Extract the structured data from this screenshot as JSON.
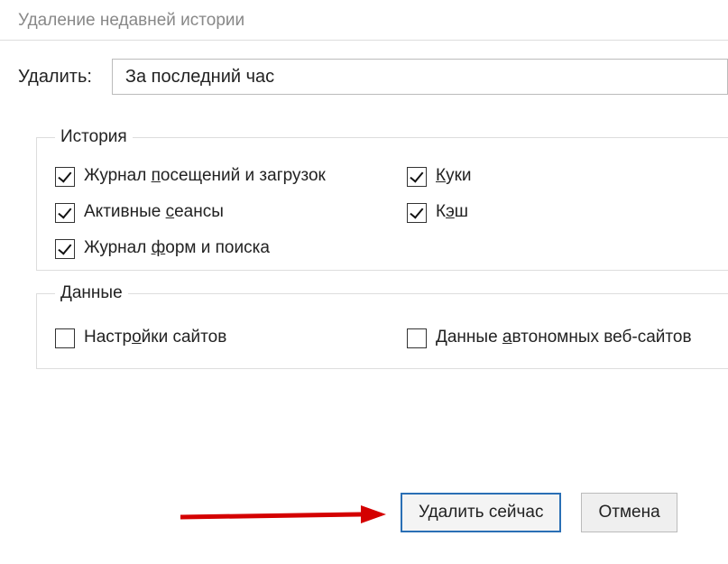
{
  "dialog": {
    "title": "Удаление недавней истории",
    "range_label": "Удалить:",
    "range_value": "За последний час"
  },
  "groups": {
    "history": {
      "legend": "История",
      "items": [
        {
          "label_pre": "Журнал ",
          "label_u": "п",
          "label_post": "осещений и загрузок",
          "checked": true
        },
        {
          "label_pre": "",
          "label_u": "К",
          "label_post": "уки",
          "checked": true
        },
        {
          "label_pre": "Активные ",
          "label_u": "с",
          "label_post": "еансы",
          "checked": true
        },
        {
          "label_pre": "К",
          "label_u": "э",
          "label_post": "ш",
          "checked": true
        },
        {
          "label_pre": "Журнал ",
          "label_u": "ф",
          "label_post": "орм и поиска",
          "checked": true
        }
      ]
    },
    "data": {
      "legend": "Данные",
      "items": [
        {
          "label_pre": "Настр",
          "label_u": "о",
          "label_post": "йки сайтов",
          "checked": false
        },
        {
          "label_pre": "Данные ",
          "label_u": "а",
          "label_post": "втономных веб-сайтов",
          "checked": false
        }
      ]
    }
  },
  "buttons": {
    "delete_now": "Удалить сейчас",
    "cancel": "Отмена"
  }
}
